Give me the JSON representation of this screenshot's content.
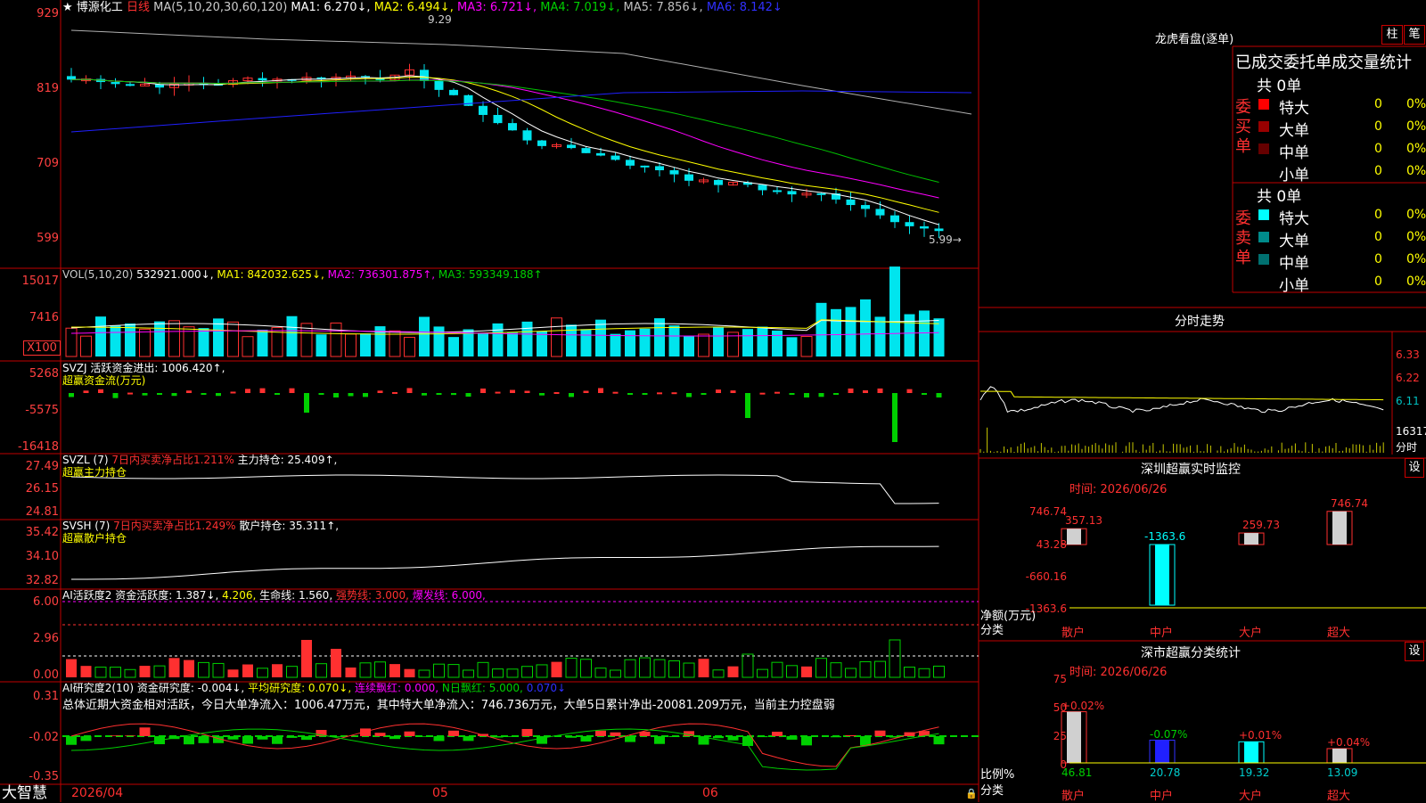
{
  "colors": {
    "up": "#ff3030",
    "down": "#00e5ee",
    "grid": "#c00000",
    "ma_white": "#ffffff",
    "ma_yellow": "#ffff00",
    "ma_magenta": "#ff00ff",
    "ma_green": "#00c000",
    "ma_gray": "#b0b0b0",
    "ma_blue": "#2020ff",
    "buy_green": "#00d000"
  },
  "title": {
    "star": "★",
    "stock_name": "博源化工",
    "period": "日线",
    "ma_params": "MA(5,10,20,30,60,120)",
    "ma1": "MA1: 6.270↓,",
    "ma2": "MA2: 6.494↓,",
    "ma3": "MA3: 6.721↓,",
    "ma4": "MA4: 7.019↓,",
    "ma5": "MA5: 7.856↓,",
    "ma6": "MA6: 8.142↓"
  },
  "price_axis": {
    "labels": [
      "929",
      "819",
      "709",
      "599"
    ]
  },
  "price_annotations": {
    "high": "9.29",
    "low": "5.99→"
  },
  "vol": {
    "header": "VOL(5,10,20)",
    "value": "532921.000↓,",
    "ma1": "MA1: 842032.625↓,",
    "ma2": "MA2: 736301.875↑,",
    "ma3": "MA3: 593349.188↑",
    "axis": [
      "15017",
      "7416",
      "X100"
    ]
  },
  "svzj": {
    "header": "SVZJ  活跃资金进出: 1006.420↑,",
    "sub": "超赢资金流(万元)",
    "axis": [
      "5268",
      "-5575",
      "-16418"
    ]
  },
  "svzl": {
    "header1": "SVZL (7)",
    "header2": "7日内买卖净占比1.211%",
    "header3": "主力持仓: 25.409↑,",
    "sub": "超赢主力持仓",
    "axis": [
      "27.49",
      "26.15",
      "24.81"
    ]
  },
  "svsh": {
    "header1": "SVSH (7)",
    "header2": "7日内买卖净占比1.249%",
    "header3": "散户持仓: 35.311↑,",
    "sub": "超赢散户持仓",
    "axis": [
      "35.42",
      "34.10",
      "32.82"
    ]
  },
  "ai1": {
    "h1": "AI活跃度2 资金活跃度: 1.387↓,",
    "h2": "4.206,",
    "h3": "生命线: 1.560,",
    "h4": "强势线: 3.000,",
    "h5": "爆发线: 6.000,",
    "axis": [
      "6.00",
      "2.96",
      "0.00"
    ]
  },
  "ai2": {
    "h1": "AI研究度2(10) 资金研究度: -0.004↓,",
    "h2": "平均研究度: 0.070↓,",
    "h3": "连续飘红: 0.000,",
    "h4": "N日飘红: 5.000,",
    "h5": "0.070↓",
    "summary": "总体近期大资金相对活跃，今日大单净流入：1006.47万元，其中特大单净流入：746.736万元，大单5日累计净出-20081.209万元，当前主力控盘弱",
    "axis": [
      "0.31",
      "-0.02",
      "-0.35"
    ]
  },
  "xaxis": {
    "brand": "大智慧",
    "labels": [
      "2026/04",
      "05",
      "06"
    ]
  },
  "lhb": {
    "title": "龙虎看盘(逐单)",
    "btn1": "柱",
    "btn2": "笔",
    "subtitle": "已成交委托单成交量统计",
    "buy": {
      "side": "委买单",
      "total": "共 0单",
      "rows": [
        {
          "label": "特大",
          "v": "0",
          "p": "0%",
          "c": "#ff0000"
        },
        {
          "label": "大单",
          "v": "0",
          "p": "0%",
          "c": "#990000"
        },
        {
          "label": "中单",
          "v": "0",
          "p": "0%",
          "c": "#660000"
        },
        {
          "label": "小单",
          "v": "0",
          "p": "0%",
          "c": ""
        }
      ]
    },
    "sell": {
      "side": "委卖单",
      "total": "共 0单",
      "rows": [
        {
          "label": "特大",
          "v": "0",
          "p": "0%",
          "c": "#00ffff"
        },
        {
          "label": "大单",
          "v": "0",
          "p": "0%",
          "c": "#008b8b"
        },
        {
          "label": "中单",
          "v": "0",
          "p": "0%",
          "c": "#007070"
        },
        {
          "label": "小单",
          "v": "0",
          "p": "0%",
          "c": ""
        }
      ]
    }
  },
  "fenshi": {
    "title": "分时走势",
    "axis": [
      "6.33",
      "6.22",
      "6.11"
    ],
    "vol_label": "16317",
    "vol_unit": "分时"
  },
  "monitor": {
    "title": "深圳超赢实时监控",
    "btn": "设",
    "time": "时间: 2026/06/26",
    "axis": [
      "746.74",
      "43.28",
      "-660.16",
      "-1363.6"
    ],
    "ylabel1": "净额(万元)",
    "ylabel2": "分类",
    "cats": [
      "散户",
      "中户",
      "大户",
      "超大"
    ],
    "values": [
      357.13,
      -1363.6,
      259.73,
      746.74
    ],
    "value_labels": [
      "357.13",
      "-1363.6",
      "259.73",
      "746.74"
    ]
  },
  "stats": {
    "title": "深市超赢分类统计",
    "btn": "设",
    "time": "时间: 2026/06/26",
    "axis": [
      "75",
      "50",
      "25",
      "0"
    ],
    "ylabel1": "比例%",
    "ylabel2": "分类",
    "cats": [
      "散户",
      "中户",
      "大户",
      "超大"
    ],
    "values": [
      46.81,
      20.78,
      19.32,
      13.09
    ],
    "value_labels": [
      "46.81",
      "20.78",
      "19.32",
      "13.09"
    ],
    "changes": [
      "+0.02%",
      "-0.07%",
      "+0.01%",
      "+0.04%"
    ]
  }
}
